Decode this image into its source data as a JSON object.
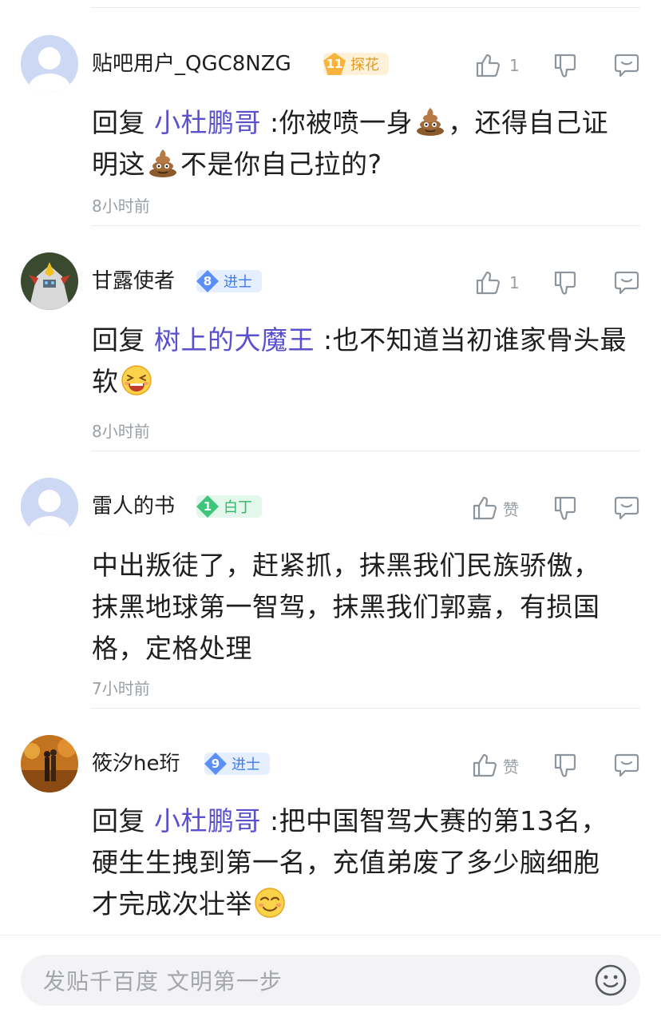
{
  "comments": [
    {
      "username": "贴吧用户_QGC8NZG",
      "level": "11",
      "badge_title": "探花",
      "like_text": "1",
      "reply_prefix": "回复",
      "mention": "小杜鹏哥",
      "line1_a": ":你被喷一身",
      "line1_b": "，还得自己证",
      "line2_a": "明这",
      "line2_b": "不是你自己拉的?",
      "time": "8小时前"
    },
    {
      "username": "甘露使者",
      "level": "8",
      "badge_title": "进士",
      "like_text": "1",
      "reply_prefix": "回复",
      "mention": "树上的大魔王",
      "line1_a": ":也不知道当初谁家骨头最",
      "line2_a": "软",
      "time": "8小时前"
    },
    {
      "username": "雷人的书",
      "level": "1",
      "badge_title": "白丁",
      "like_text": "赞",
      "line1": "中出叛徒了，赶紧抓，抹黑我们民族骄傲，",
      "line2": "抹黑地球第一智驾，抹黑我们郭嘉，有损国",
      "line3": "格，定格处理",
      "time": "7小时前"
    },
    {
      "username": "筱汐he珩",
      "level": "9",
      "badge_title": "进士",
      "like_text": "赞",
      "reply_prefix": "回复",
      "mention": "小杜鹏哥",
      "line1_a": ":把中国智驾大赛的第13名，",
      "line2": "硬生生拽到第一名，充值弟废了多少脑细胞",
      "line3_a": "才完成次壮举"
    }
  ],
  "input": {
    "placeholder": "发贴千百度 文明第一步"
  },
  "colors": {
    "mention": "#5a4fcf",
    "muted": "#9aa0a6",
    "badge_gold": "#f6b33d",
    "badge_blue": "#5b8ff5",
    "badge_green": "#3fc57b"
  },
  "icons": [
    "thumbs-up-icon",
    "thumbs-down-icon",
    "reply-bubble-icon",
    "poop-emoji-icon",
    "laughing-emoji-icon",
    "smug-emoji-icon",
    "emoji-face-icon"
  ]
}
